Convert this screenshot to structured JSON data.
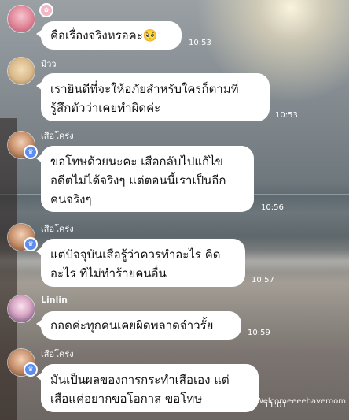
{
  "messages": [
    {
      "sender": "",
      "text": "คือเรื่องจริงหรอคะ🥺",
      "time": "10:53"
    },
    {
      "sender": "มีวว",
      "text": "เรายินดีที่จะให้อภัยสำหรับใครก็ตามที่\nรู้สึกตัวว่าเคยทำผิดค่ะ",
      "time": "10:53"
    },
    {
      "sender": "เสือโคร่ง",
      "text": "ขอโทษด้วยนะคะ เสือกลับไปแก้ไข\nอดีตไม่ได้จริงๆ แต่ตอนนี้เราเป็นอีก\nคนจริงๆ",
      "time": "10:56"
    },
    {
      "sender": "เสือโคร่ง",
      "text": "แต่ปัจจุบันเสือรู้ว่าควรทำอะไร คิด\nอะไร ที่ไม่ทำร้ายคนอื่น",
      "time": "10:57"
    },
    {
      "sender": "Linlin",
      "text": "กอดค่ะทุกคนเคยผิดพลาดจำวรั้ย",
      "time": "10:59"
    },
    {
      "sender": "เสือโคร่ง",
      "text": "มันเป็นผลของการกระทำเสือเอง แต่\nเสือแค่อยากขอโอกาส ขอโทษ",
      "time": "11:01"
    }
  ],
  "watermark": "Welcomeeeehaveroom",
  "colors": {
    "bubble": "#ffffff",
    "badge": "#5d8df0"
  }
}
